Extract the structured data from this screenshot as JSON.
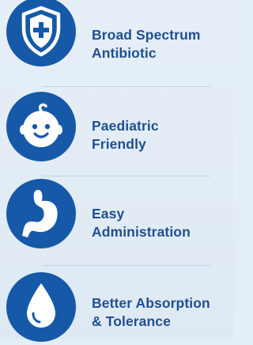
{
  "colors": {
    "accent": "#1659a8",
    "text": "#1f4f92",
    "background": "#e4eef6"
  },
  "features": [
    {
      "icon": "shield-plus-icon",
      "line1": "Broad Spectrum",
      "line2": "Antibiotic"
    },
    {
      "icon": "baby-face-icon",
      "line1": "Paediatric",
      "line2": "Friendly"
    },
    {
      "icon": "stomach-icon",
      "line1": "Easy",
      "line2": "Administration"
    },
    {
      "icon": "water-drop-icon",
      "line1": "Better Absorption",
      "line2": "& Tolerance"
    }
  ]
}
